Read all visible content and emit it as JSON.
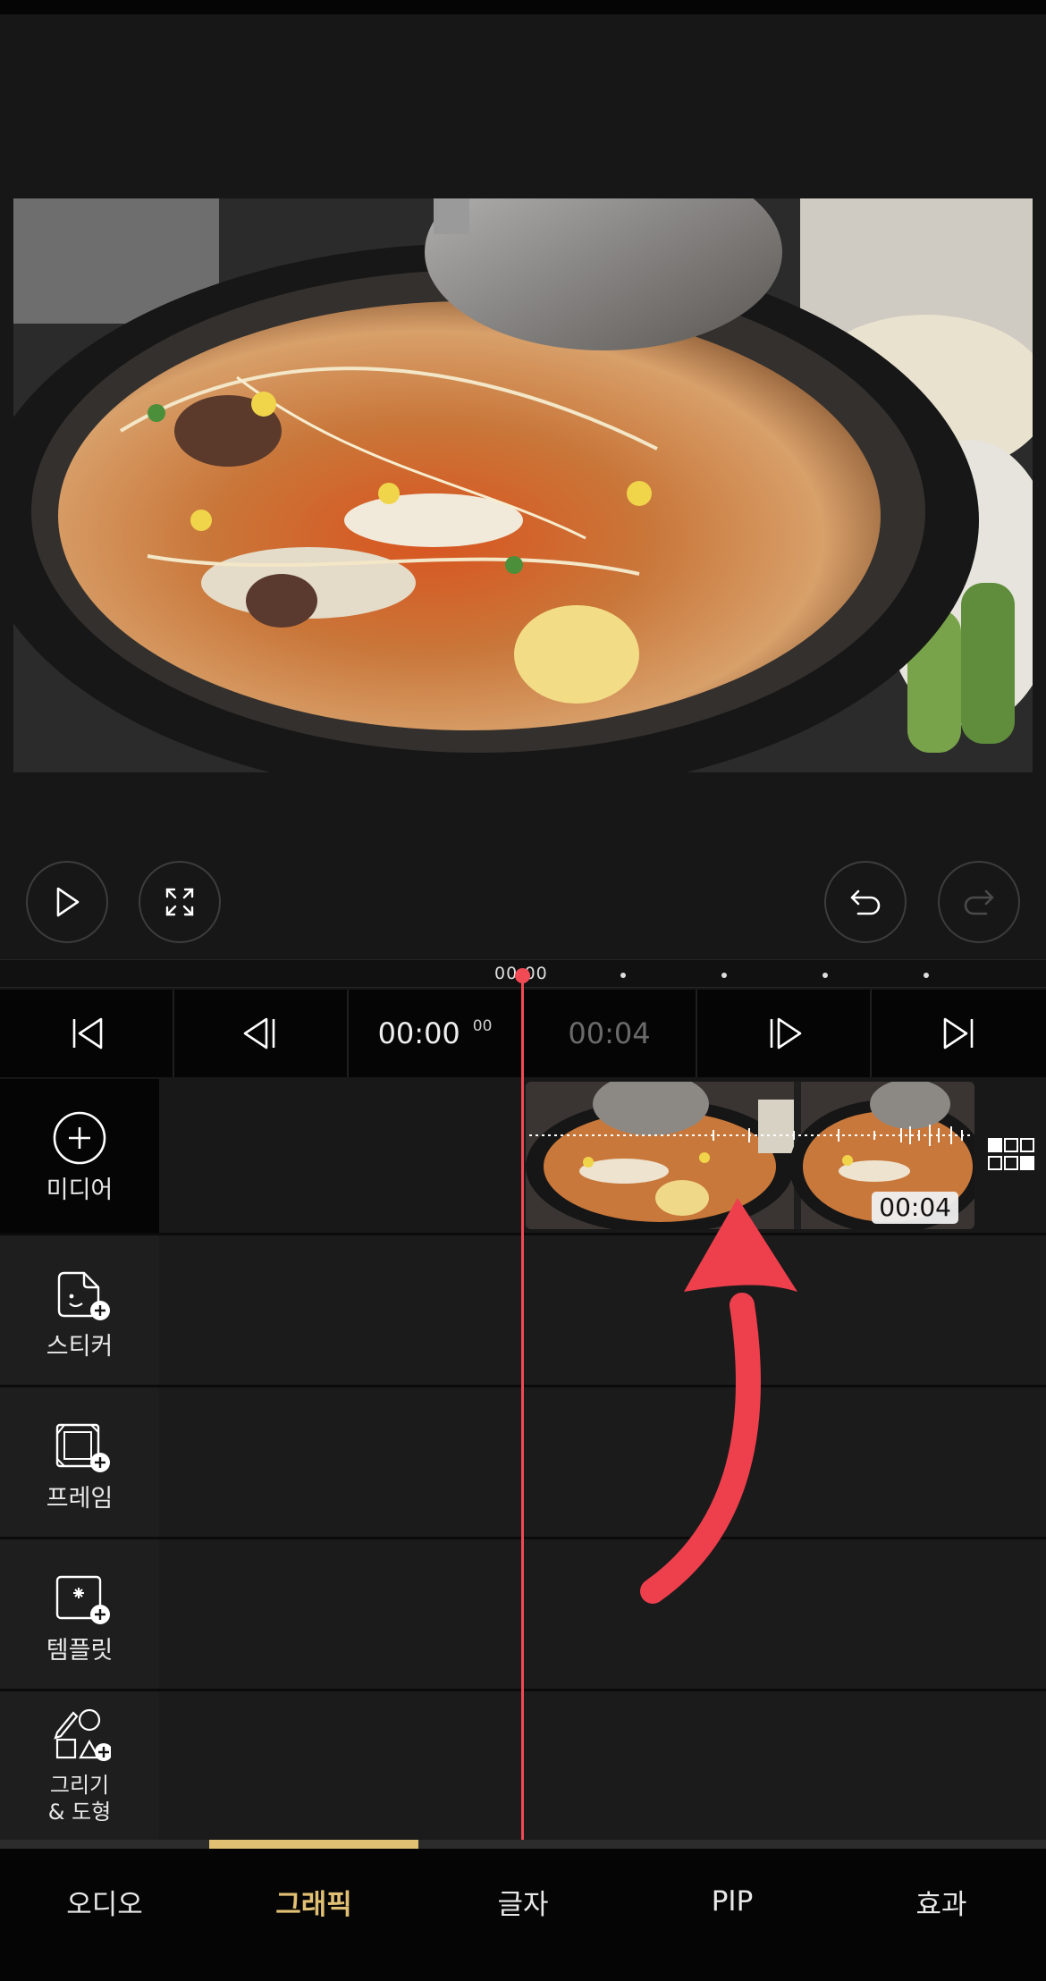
{
  "controls": {
    "play_icon": "play-icon",
    "fullscreen_icon": "fullscreen-icon",
    "undo_icon": "undo-icon",
    "redo_icon": "redo-icon"
  },
  "ruler": {
    "current_label": "00:00"
  },
  "transport": {
    "current_time": "00:00",
    "current_frames": "00",
    "total_time": "00:04"
  },
  "tools": [
    {
      "label": "미디어",
      "icon": "plus-circle-icon"
    },
    {
      "label": "스티커",
      "icon": "sticker-add-icon"
    },
    {
      "label": "프레임",
      "icon": "frame-add-icon"
    },
    {
      "label": "템플릿",
      "icon": "template-add-icon"
    },
    {
      "label": "그리기\n& 도형",
      "icon": "draw-shape-add-icon"
    }
  ],
  "clip": {
    "duration_badge": "00:04"
  },
  "tabs": [
    {
      "label": "오디오",
      "active": false
    },
    {
      "label": "그래픽",
      "active": true
    },
    {
      "label": "글자",
      "active": false
    },
    {
      "label": "PIP",
      "active": false
    },
    {
      "label": "효과",
      "active": false
    }
  ],
  "colors": {
    "accent": "#e1c073",
    "playhead": "#f24a55",
    "annotation_arrow": "#ee3f4c"
  }
}
